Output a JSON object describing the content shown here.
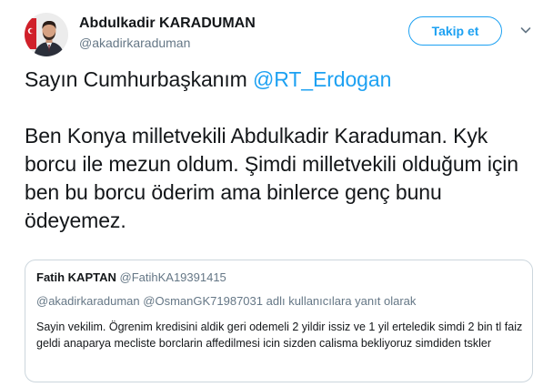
{
  "colors": {
    "accent": "#1da1f2",
    "text_primary": "#14171a",
    "text_secondary": "#657786",
    "border": "#ccd6dd"
  },
  "author": {
    "name": "Abdulkadir KARADUMAN",
    "handle": "@akadirkaraduman",
    "avatar_icon": "profile-photo"
  },
  "actions": {
    "follow_label": "Takip et",
    "more_icon": "chevron-down-icon"
  },
  "tweet": {
    "para1_prefix": "Sayın Cumhurbaşkanım ",
    "mention": "@RT_Erdogan",
    "para2": "Ben Konya milletvekili Abdulkadir Karaduman. Kyk borcu ile mezun oldum. Şimdi milletvekili olduğum için ben bu borcu öderim ama binlerce genç bunu ödeyemez."
  },
  "quoted_tweet": {
    "name": "Fatih KAPTAN",
    "handle": "@FatihKA19391415",
    "reply_to_user1": "@akadirkaraduman",
    "reply_to_user2": "@OsmanGK71987031",
    "reply_suffix": " adlı kullanıcılara yanıt olarak",
    "text": "Sayin vekilim. Ögrenim kredisini aldik geri odemeli 2 yildir issiz ve 1 yil erteledik simdi 2 bin tl faiz geldi anaparya mecliste borclarin affedilmesi icin sizden calisma bekliyoruz simdiden tskler"
  }
}
